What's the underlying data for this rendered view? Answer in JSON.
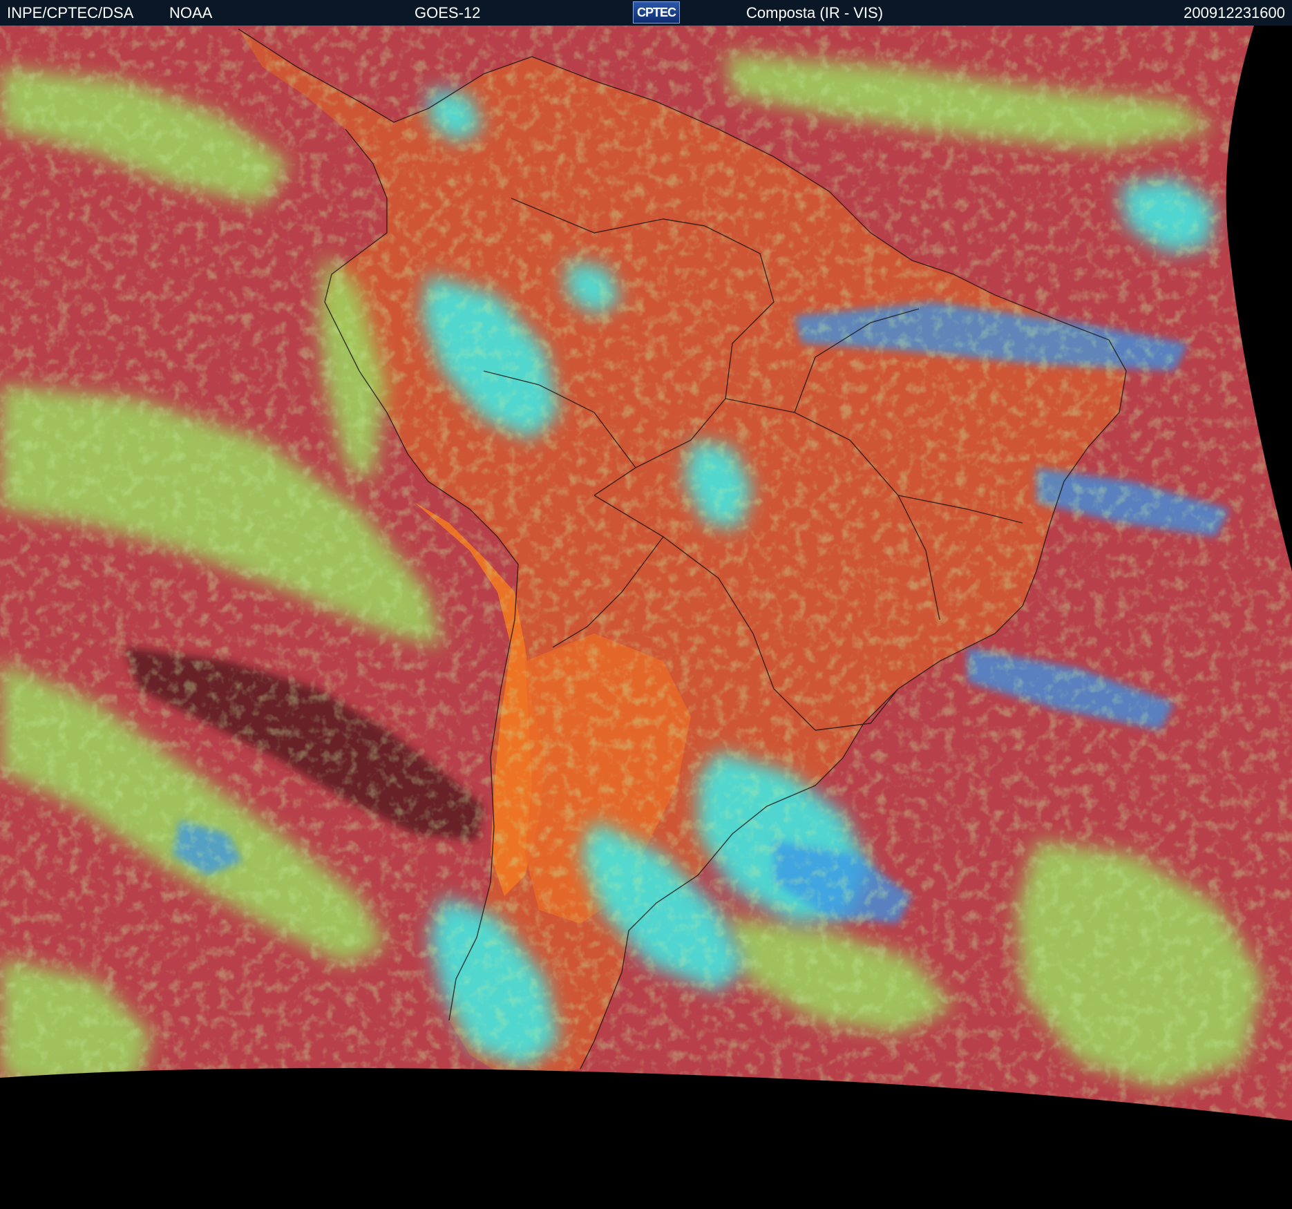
{
  "header": {
    "agency": "INPE/CPTEC/DSA",
    "partner": "NOAA",
    "satellite": "GOES-12",
    "logo_text": "CPTEC",
    "product": "Composta (IR - VIS)",
    "timestamp": "200912231600"
  },
  "colors": {
    "header_bg": "#0a1726",
    "clear_ocean": "#b8404a",
    "warm_land": "#d85a30",
    "andes_hot": "#f07a20",
    "low_cloud": "#9ad860",
    "high_cloud": "#40e8e0",
    "deep_cloud": "#3a9ae8",
    "very_cold": "#5a1820",
    "space": "#000000"
  }
}
